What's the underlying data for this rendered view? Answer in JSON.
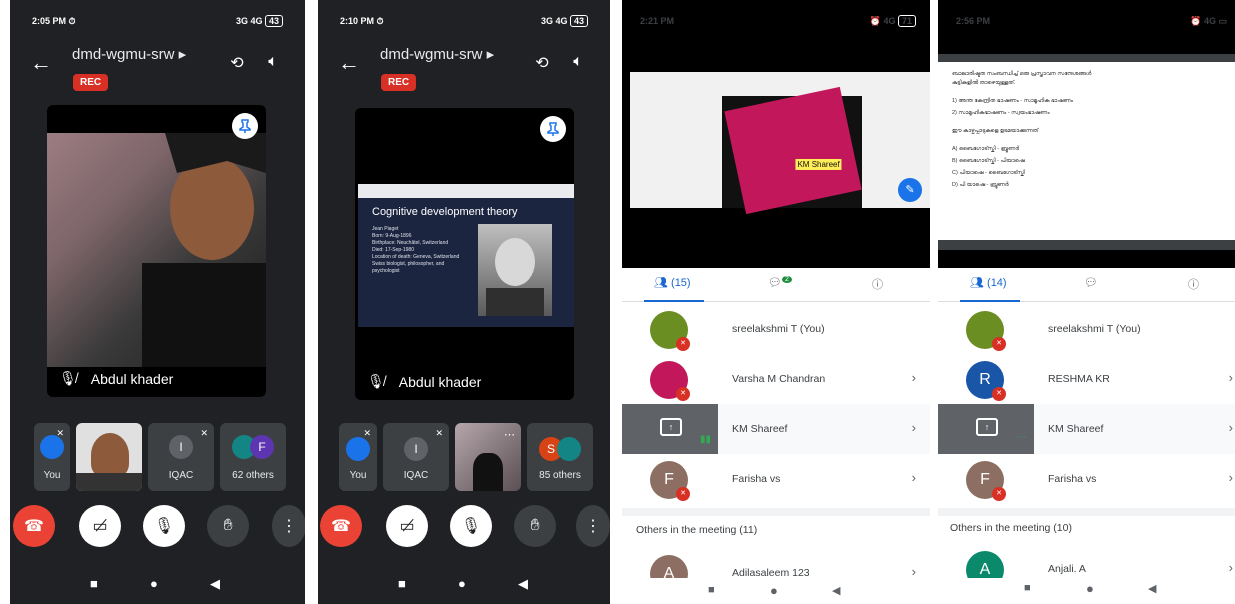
{
  "phone1": {
    "time": "2:05 PM",
    "signal": "3G 4G",
    "battery": "43",
    "meeting": "dmd-wgmu-srw ▸",
    "rec": "REC",
    "speaker": "Abdul khader",
    "tiles": [
      {
        "label": "You"
      },
      {
        "label": ""
      },
      {
        "label": "IQAC",
        "initial": "I"
      },
      {
        "label": "62 others",
        "initial": "F"
      }
    ]
  },
  "phone2": {
    "time": "2:10 PM",
    "signal": "3G 4G",
    "battery": "43",
    "meeting": "dmd-wgmu-srw ▸",
    "rec": "REC",
    "speaker": "Abdul khader",
    "slide_title": "Cognitive development theory",
    "slide_bullets": [
      "Jean Piaget",
      "Born: 9-Aug-1896",
      "Birthplace: Neuchâtel, Switzerland",
      "Died: 17-Sep-1980",
      "Location of death: Geneva, Switzerland",
      "Swiss biologist, philosopher, and psychologist"
    ],
    "tiles": [
      {
        "label": "You"
      },
      {
        "label": "IQAC",
        "initial": "I"
      },
      {
        "label": ""
      },
      {
        "label": "85 others",
        "initial": "S"
      }
    ]
  },
  "phone3": {
    "time": "2:21 PM",
    "signal": "4G",
    "battery": "71",
    "slide_highlight": "KM Shareef",
    "people_count": "(15)",
    "chat_badge": "2",
    "participants": [
      {
        "name": "sreelakshmi T (You)",
        "initial": "",
        "color": "#6b8e23"
      },
      {
        "name": "Varsha M Chandran",
        "initial": "",
        "color": "#c2185b"
      },
      {
        "name": "KM Shareef",
        "initial": "",
        "color": "#5f6368"
      },
      {
        "name": "Farisha vs",
        "initial": "F",
        "color": "#8d6e63"
      }
    ],
    "others_header": "Others in the meeting (11)",
    "other_first": {
      "name": "Adilasaleem 123",
      "initial": "A",
      "color": "#8d6e63"
    }
  },
  "phone4": {
    "time": "2:56 PM",
    "signal": "4G",
    "people_count": "(14)",
    "doc_lines": [
      "ബാലാരിഷ്ടത സംബന്ധിച്ച് ഒരു പ്രസ്താവന സന്ദേശങ്ങൾ",
      "കുട്ടികളിൽ താഴെയുള്ളത്.",
      "1)  അന്ത കേന്ദ്രിത ഭാഷണം - സാമൂഹിക ഭാഷണം",
      "2)  സാമൂഹികഭാഷണം - സ്വയംഭാഷണം",
      "ഈ കാഴ്ചപ്പാടുകളെ ഉടമയാക്കുന്നത്",
      "A)  ബൈഗോട്സ്കി - ബ്രൂണർ",
      "B)  ബൈഗോട്സ്കി - പിയാഷെ",
      "C)  പിയാഷെ - ബൈഗോട്സ്കി",
      "D)  പി യാഷെ - ബ്രൂണർ"
    ],
    "participants": [
      {
        "name": "sreelakshmi T (You)",
        "initial": "",
        "color": "#6b8e23"
      },
      {
        "name": "RESHMA KR",
        "initial": "R",
        "color": "#1a56a8"
      },
      {
        "name": "KM Shareef",
        "initial": "",
        "color": "#5f6368"
      },
      {
        "name": "Farisha vs",
        "initial": "F",
        "color": "#8d6e63"
      }
    ],
    "others_header": "Others in the meeting (10)",
    "other_first": {
      "name": "Anjali. A",
      "initial": "A",
      "color": "#0b8a6b"
    }
  },
  "colors": {
    "red": "#d93025",
    "blue": "#1a73e8",
    "dark": "#202124",
    "tile": "#3c4043"
  }
}
